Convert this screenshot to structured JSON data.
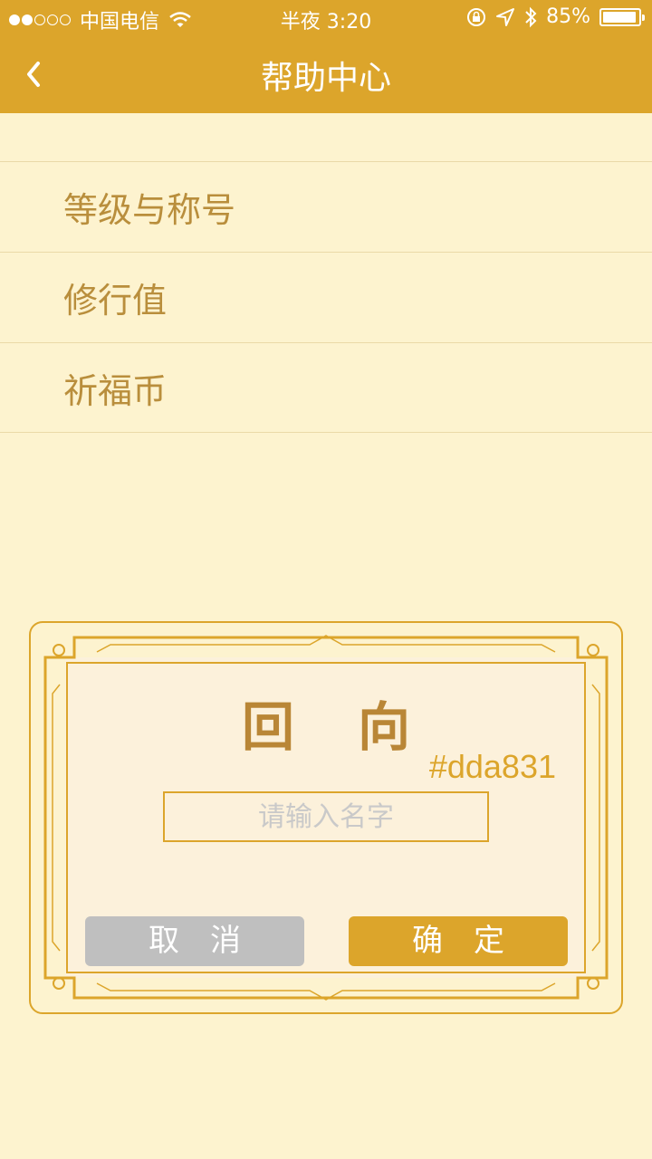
{
  "status_bar": {
    "carrier": "中国电信",
    "time": "半夜 3:20",
    "battery": "85%",
    "battery_level": 0.85
  },
  "nav": {
    "title": "帮助中心",
    "back_icon": "chevron-left-icon"
  },
  "help_items": [
    {
      "label": "等级与称号"
    },
    {
      "label": "修行值"
    },
    {
      "label": "祈福币"
    }
  ],
  "dialog": {
    "title": "回向",
    "color_code": "#dda831",
    "name_input": {
      "placeholder": "请输入名字",
      "value": ""
    },
    "cancel_label": "取消",
    "confirm_label": "确定"
  },
  "colors": {
    "accent": "#dca52b",
    "background": "#fdf3cf",
    "text": "#b98e3c",
    "cancel": "#bfbfbf"
  }
}
